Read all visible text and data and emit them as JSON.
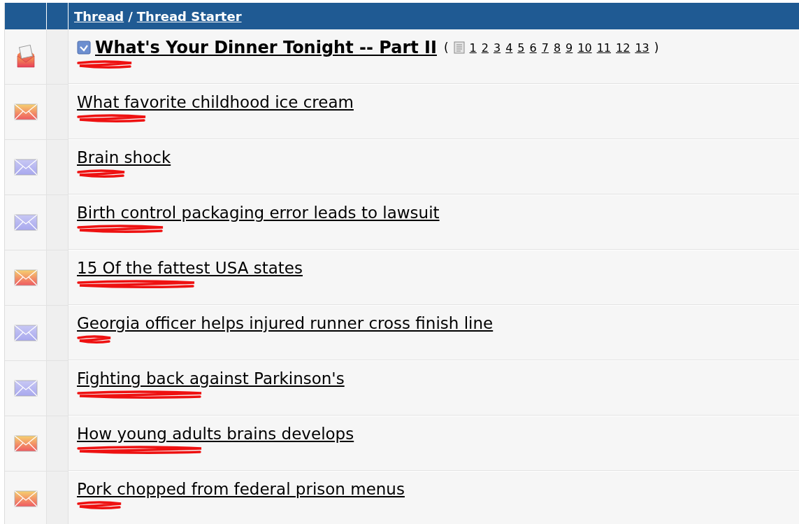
{
  "header": {
    "thread_link": "Thread",
    "separator": "/",
    "starter_link": "Thread Starter"
  },
  "threads": [
    {
      "kind": "hot",
      "title": "What's Your Dinner Tonight -- Part II",
      "sticky": true,
      "pages_open": "(",
      "pages_close": ")",
      "pages": [
        "1",
        "2",
        "3",
        "4",
        "5",
        "6",
        "7",
        "8",
        "9",
        "10",
        "11",
        "12",
        "13"
      ],
      "starter_hidden": true
    },
    {
      "kind": "new",
      "title": "What favorite childhood ice cream",
      "sticky": false,
      "starter_hidden": true
    },
    {
      "kind": "old",
      "title": "Brain shock",
      "sticky": false,
      "starter_hidden": true
    },
    {
      "kind": "old",
      "title": "Birth control packaging error leads to lawsuit",
      "sticky": false,
      "starter_hidden": true
    },
    {
      "kind": "new",
      "title": "15 Of the fattest USA states",
      "sticky": false,
      "starter_hidden": true
    },
    {
      "kind": "old",
      "title": "Georgia officer helps injured runner cross finish line",
      "sticky": false,
      "starter_hidden": true
    },
    {
      "kind": "old",
      "title": "Fighting back against Parkinson's",
      "sticky": false,
      "starter_hidden": true
    },
    {
      "kind": "new",
      "title": "How young adults brains develops",
      "sticky": false,
      "starter_hidden": true
    },
    {
      "kind": "new",
      "title": "Pork chopped from federal prison menus",
      "sticky": false,
      "starter_hidden": true
    }
  ]
}
